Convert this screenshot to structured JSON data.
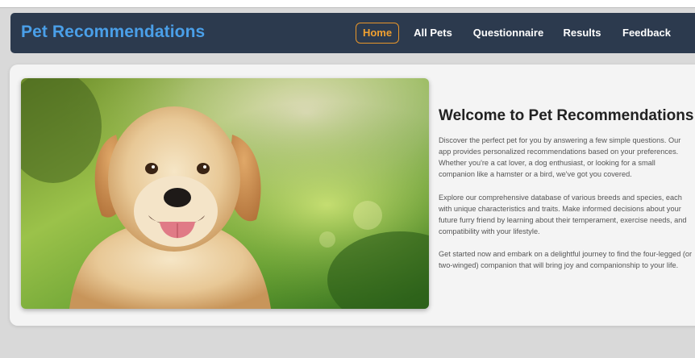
{
  "app": {
    "brand": "Pet Recommendations"
  },
  "nav": {
    "items": [
      {
        "id": "home",
        "label": "Home",
        "active": true
      },
      {
        "id": "all-pets",
        "label": "All Pets",
        "active": false
      },
      {
        "id": "questionnaire",
        "label": "Questionnaire",
        "active": false
      },
      {
        "id": "results",
        "label": "Results",
        "active": false
      },
      {
        "id": "feedback",
        "label": "Feedback",
        "active": false
      }
    ]
  },
  "hero": {
    "title": "Welcome to Pet Recommendations",
    "paragraphs": [
      "Discover the perfect pet for you by answering a few simple questions. Our app provides personalized recommendations based on your preferences. Whether you're a cat lover, a dog enthusiast, or looking for a small companion like a hamster or a bird, we've got you covered.",
      "Explore our comprehensive database of various breeds and species, each with unique characteristics and traits. Make informed decisions about your future furry friend by learning about their temperament, exercise needs, and compatibility with your lifestyle.",
      "Get started now and embark on a delightful journey to find the four-legged (or two-winged) companion that will bring joy and companionship to your life."
    ]
  },
  "colors": {
    "navbar_bg": "#2c3a4e",
    "brand": "#4a9fe8",
    "active_nav": "#f0a030",
    "page_bg": "#d9d9d9",
    "card_bg": "#f4f4f4"
  }
}
